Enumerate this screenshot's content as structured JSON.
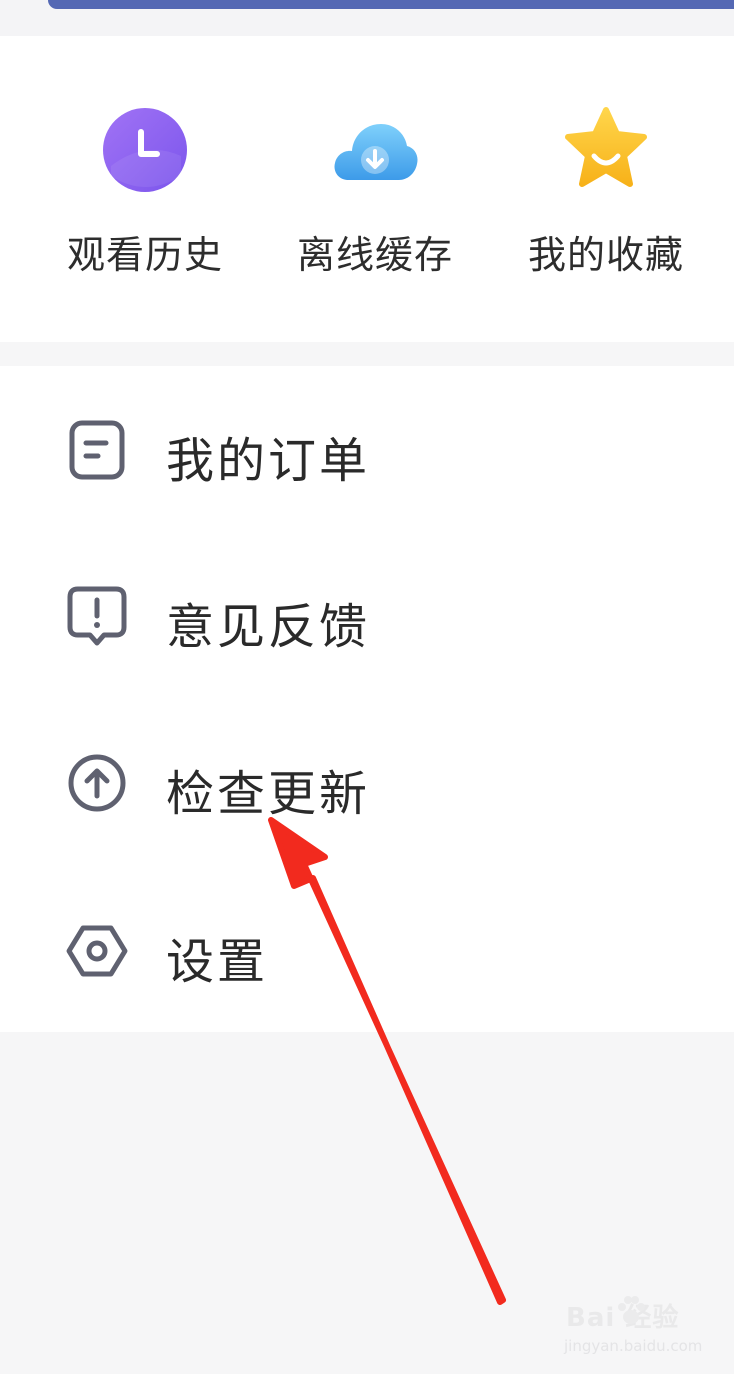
{
  "quick_access": {
    "items": [
      {
        "label": "观看历史",
        "icon": "clock-icon"
      },
      {
        "label": "离线缓存",
        "icon": "cloud-download-icon"
      },
      {
        "label": "我的收藏",
        "icon": "star-icon"
      }
    ]
  },
  "menu": {
    "items": [
      {
        "label": "我的订单",
        "icon": "order-icon"
      },
      {
        "label": "意见反馈",
        "icon": "feedback-icon"
      },
      {
        "label": "检查更新",
        "icon": "upload-arrow-icon"
      },
      {
        "label": "设置",
        "icon": "hexagon-settings-icon"
      }
    ]
  },
  "watermark": {
    "brand": "Bai  经验",
    "url": "jingyan.baidu.com"
  },
  "colors": {
    "banner": "#5468b4",
    "history_icon": "#8f63f1",
    "cloud_icon": "#5cb4f0",
    "star_icon": "#fbc02d",
    "menu_icon_stroke": "#5f6170",
    "annotation_arrow": "#f22a1e"
  }
}
